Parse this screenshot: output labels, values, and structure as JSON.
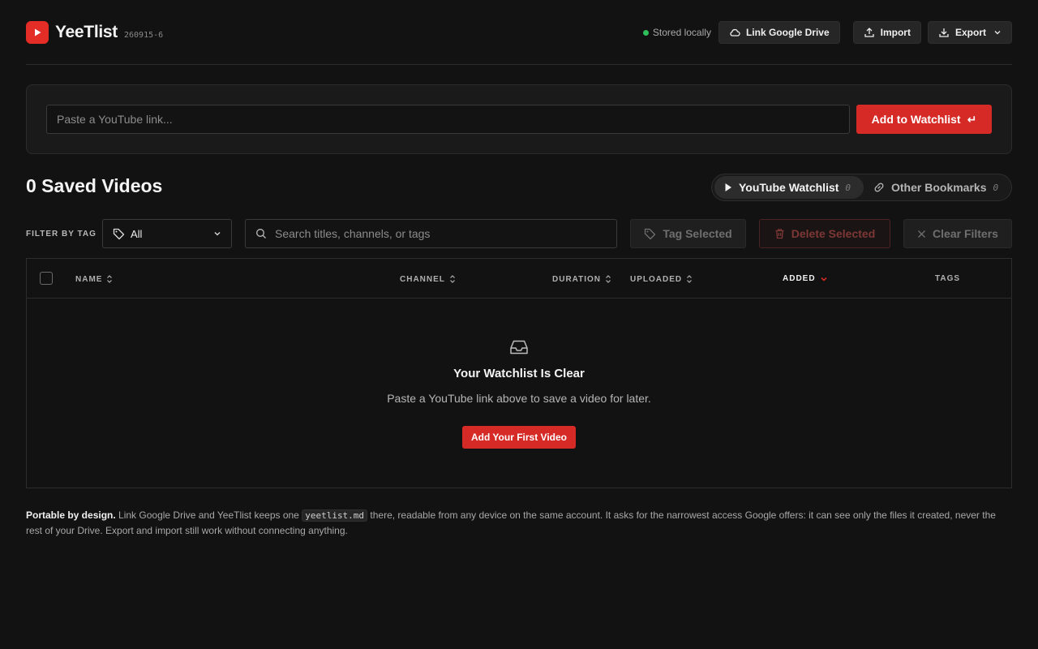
{
  "header": {
    "app_name": "YeeTlist",
    "version": "260915-6",
    "status_text": "Stored locally",
    "status_color": "#2fbf5a",
    "link_drive_label": "Link Google Drive",
    "import_label": "Import",
    "export_label": "Export",
    "brand_color": "#e52d27"
  },
  "add": {
    "placeholder": "Paste a YouTube link...",
    "button_label": "Add to Watchlist",
    "button_icon": "↵"
  },
  "list": {
    "count_title": "0 Saved Videos",
    "tabs": [
      {
        "label": "YouTube Watchlist",
        "count": "0",
        "icon": "play-icon"
      },
      {
        "label": "Other Bookmarks",
        "count": "0",
        "icon": "link-icon"
      }
    ]
  },
  "filters": {
    "tag_label": "FILTER BY TAG",
    "tag_value": "All",
    "search_placeholder": "Search titles, channels, or tags",
    "tag_selected": "Tag Selected",
    "delete_selected": "Delete Selected",
    "clear_filters": "Clear Filters"
  },
  "table": {
    "columns": [
      "NAME",
      "CHANNEL",
      "DURATION",
      "UPLOADED",
      "ADDED",
      "TAGS"
    ],
    "sorted_column": "ADDED",
    "empty_title": "Your Watchlist Is Clear",
    "empty_subtitle": "Paste a YouTube link above to save a video for later.",
    "empty_button": "Add Your First Video"
  },
  "note": {
    "bold": "Portable by design.",
    "part1": "Link Google Drive and YeeTlist keeps one",
    "code": "yeetlist.md",
    "part2": "there, readable from any device on the same account. It asks for the narrowest access Google offers: it can see only the files it created, never the rest of your Drive. Export and import still work without connecting anything."
  }
}
